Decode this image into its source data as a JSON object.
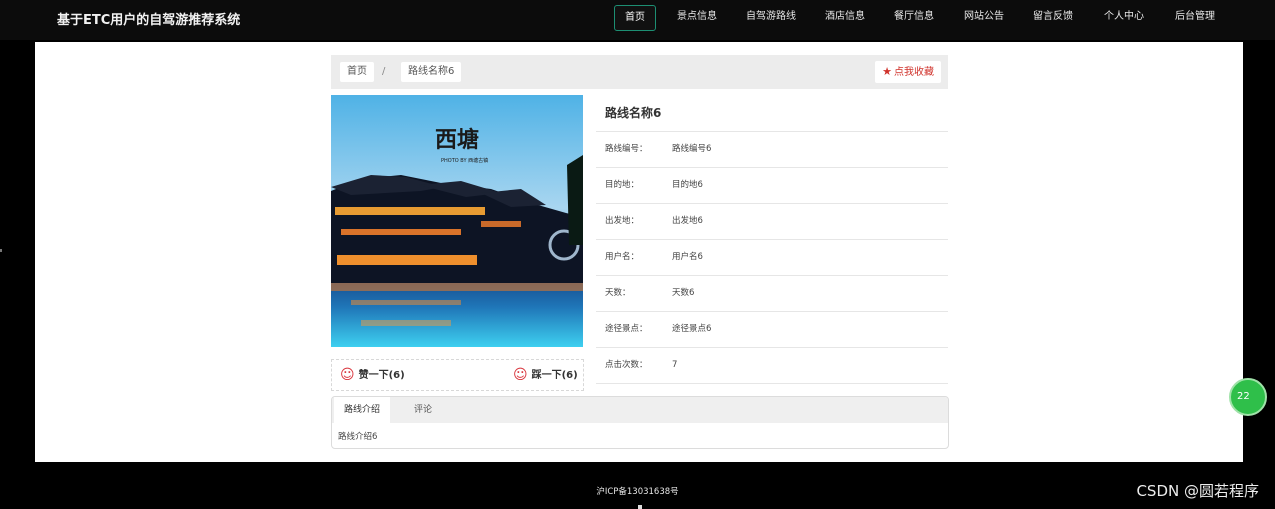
{
  "site": {
    "title": "基于ETC用户的自驾游推荐系统"
  },
  "nav": [
    {
      "label": "首页"
    },
    {
      "label": "景点信息"
    },
    {
      "label": "自驾游路线"
    },
    {
      "label": "酒店信息"
    },
    {
      "label": "餐厅信息"
    },
    {
      "label": "网站公告"
    },
    {
      "label": "留言反馈"
    },
    {
      "label": "个人中心"
    },
    {
      "label": "后台管理"
    }
  ],
  "breadcrumb": {
    "home": "首页",
    "separator": "/",
    "current": "路线名称6"
  },
  "favorite_button": {
    "label": "点我收藏",
    "icon": "star-icon"
  },
  "photo": {
    "caption_main": "西塘",
    "caption_sub": "PHOTO BY 西塘古镇"
  },
  "votes": {
    "like": "赞一下(6)",
    "dislike": "踩一下(6)",
    "icon": "smile-icon"
  },
  "detail": {
    "title": "路线名称6",
    "rows": [
      {
        "label": "路线编号：",
        "value": "路线编号6"
      },
      {
        "label": "目的地：",
        "value": "目的地6"
      },
      {
        "label": "出发地：",
        "value": "出发地6"
      },
      {
        "label": "用户名：",
        "value": "用户名6"
      },
      {
        "label": "天数：",
        "value": "天数6"
      },
      {
        "label": "途径景点：",
        "value": "途径景点6"
      },
      {
        "label": "点击次数：",
        "value": "7"
      }
    ]
  },
  "tabs": [
    {
      "label": "路线介绍"
    },
    {
      "label": "评论"
    }
  ],
  "tab_content": "路线介绍6",
  "footer": {
    "icp": "沪ICP备13031638号"
  },
  "watermark": "CSDN @圆若程序",
  "float_badge": "22",
  "colors": {
    "accent": "#1d8f73",
    "favorite": "#d0322b",
    "badge": "#2fbf4a"
  }
}
